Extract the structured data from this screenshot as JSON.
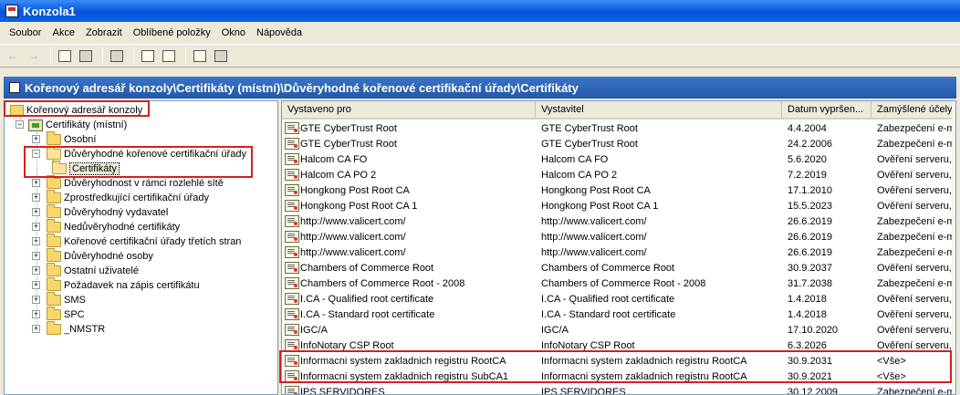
{
  "window": {
    "title": "Konzola1"
  },
  "menu": [
    "Soubor",
    "Akce",
    "Zobrazit",
    "Oblíbené položky",
    "Okno",
    "Nápověda"
  ],
  "path_bar": "Kořenový adresář konzoly\\Certifikáty (místní)\\Důvěryhodné kořenové certifikační úřady\\Certifikáty",
  "tree": {
    "root": "Kořenový adresář konzoly",
    "store": "Certifikáty (místní)",
    "items": [
      {
        "label": "Osobní",
        "expanded": false
      },
      {
        "label": "Důvěryhodné kořenové certifikační úřady",
        "expanded": true,
        "child": "Certifikáty"
      },
      {
        "label": "Důvěryhodnost v rámci rozlehlé sítě",
        "expanded": false
      },
      {
        "label": "Zprostředkující certifikační úřady",
        "expanded": false
      },
      {
        "label": "Důvěryhodný vydavatel",
        "expanded": false
      },
      {
        "label": "Nedůvěryhodné certifikáty",
        "expanded": false
      },
      {
        "label": "Kořenové certifikační úřady třetích stran",
        "expanded": false
      },
      {
        "label": "Důvěryhodné osoby",
        "expanded": false
      },
      {
        "label": "Ostatní uživatelé",
        "expanded": false
      },
      {
        "label": "Požadavek na zápis certifikátu",
        "expanded": false
      },
      {
        "label": "SMS",
        "expanded": false
      },
      {
        "label": "SPC",
        "expanded": false
      },
      {
        "label": "_NMSTR",
        "expanded": false
      }
    ]
  },
  "columns": [
    "Vystaveno pro",
    "Vystavitel",
    "Datum vypršen...",
    "Zamýšlené účely"
  ],
  "rows": [
    [
      "GTE CyberTrust Root",
      "GTE CyberTrust Root",
      "4.4.2004",
      "Zabezpečení e-mailu"
    ],
    [
      "GTE CyberTrust Root",
      "GTE CyberTrust Root",
      "24.2.2006",
      "Zabezpečení e-mailu"
    ],
    [
      "Halcom CA FO",
      "Halcom CA FO",
      "5.6.2020",
      "Ověření serveru, Ověření"
    ],
    [
      "Halcom CA PO 2",
      "Halcom CA PO 2",
      "7.2.2019",
      "Ověření serveru, Ověření"
    ],
    [
      "Hongkong Post Root CA",
      "Hongkong Post Root CA",
      "17.1.2010",
      "Ověření serveru, Ověření"
    ],
    [
      "Hongkong Post Root CA 1",
      "Hongkong Post Root CA 1",
      "15.5.2023",
      "Ověření serveru, Ověření"
    ],
    [
      "http://www.valicert.com/",
      "http://www.valicert.com/",
      "26.6.2019",
      "Zabezpečení e-mailu"
    ],
    [
      "http://www.valicert.com/",
      "http://www.valicert.com/",
      "26.6.2019",
      "Zabezpečení e-mailu"
    ],
    [
      "http://www.valicert.com/",
      "http://www.valicert.com/",
      "26.6.2019",
      "Zabezpečení e-mailu"
    ],
    [
      "Chambers of Commerce Root",
      "Chambers of Commerce Root",
      "30.9.2037",
      "Ověření serveru, Ověření"
    ],
    [
      "Chambers of Commerce Root - 2008",
      "Chambers of Commerce Root - 2008",
      "31.7.2038",
      "Zabezpečení e-mailu"
    ],
    [
      "I.CA - Qualified root certificate",
      "I.CA - Qualified root certificate",
      "1.4.2018",
      "Ověření serveru, Ověření"
    ],
    [
      "I.CA - Standard root certificate",
      "I.CA - Standard root certificate",
      "1.4.2018",
      "Ověření serveru, Ověření"
    ],
    [
      "IGC/A",
      "IGC/A",
      "17.10.2020",
      "Ověření serveru, Ověření"
    ],
    [
      "InfoNotary CSP Root",
      "InfoNotary CSP Root",
      "6.3.2026",
      "Ověření serveru, Ověření"
    ],
    [
      "Informacni system zakladnich registru RootCA",
      "Informacni system zakladnich registru RootCA",
      "30.9.2031",
      "<Vše>"
    ],
    [
      "Informacni system zakladnich registru SubCA1",
      "Informacni system zakladnich registru RootCA",
      "30.9.2021",
      "<Vše>"
    ],
    [
      "IPS SERVIDORES",
      "IPS SERVIDORES",
      "30.12.2009",
      "Zabezpečení e-mailu"
    ]
  ],
  "colors": {
    "highlight": "#d0211f",
    "title_blue": "#0a5fe0",
    "path_blue": "#2f66b8"
  }
}
